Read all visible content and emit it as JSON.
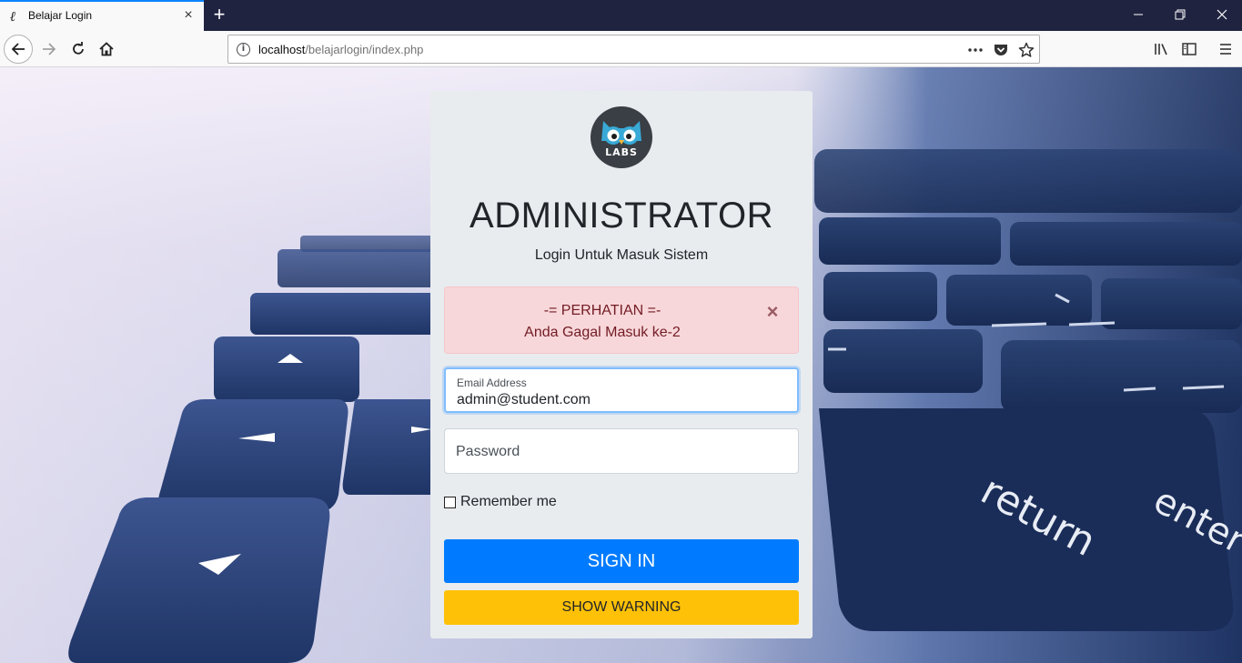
{
  "browser": {
    "tab": {
      "title": "Belajar Login",
      "favicon": "ℓ"
    },
    "url": {
      "host": "localhost",
      "path": "/belajarlogin/index.php"
    }
  },
  "login": {
    "title": "ADMINISTRATOR",
    "subtitle": "Login Untuk Masuk Sistem",
    "logo_text": "LABS",
    "alert": {
      "heading": "-= PERHATIAN =-",
      "message": "Anda Gagal Masuk ke-2",
      "close": "×"
    },
    "email": {
      "label": "Email Address",
      "value": "admin@student.com"
    },
    "password": {
      "placeholder": "Password"
    },
    "remember_label": "Remember me",
    "signin_label": "SIGN IN",
    "warning_label": "SHOW WARNING"
  },
  "colors": {
    "primary": "#007bff",
    "warning": "#ffc107",
    "danger_bg": "#f8d7da",
    "danger_text": "#721c24"
  }
}
